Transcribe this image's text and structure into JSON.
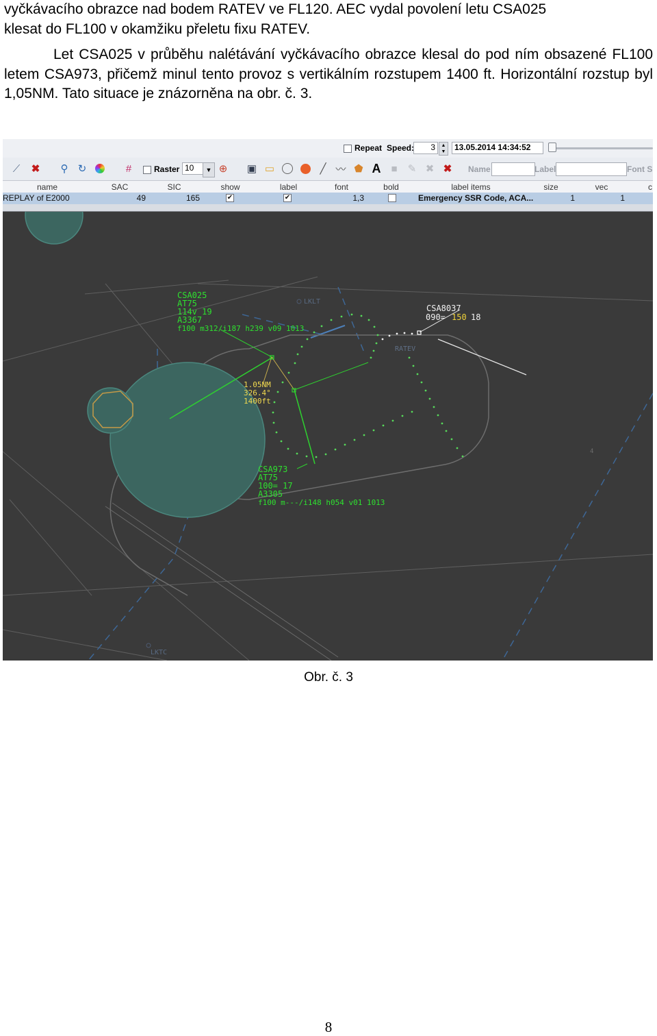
{
  "text": {
    "line1": "vyčkávacího obrazce nad bodem RATEV ve FL120. AEC vydal povolení letu CSA025",
    "line2": "klesat do FL100 v okamžiku přeletu fixu RATEV.",
    "para2": "Let CSA025 v průběhu nalétávání vyčkávacího obrazce klesal do pod ním obsazené FL100 letem CSA973, přičemž minul tento provoz s vertikálním rozstupem 1400 ft. Horizontální rozstup byl 1,05NM. Tato situace je znázorněna na obr. č. 3."
  },
  "toolbar_top": {
    "repeat_label": "Repeat",
    "speed_label": "Speed:",
    "speed_value": "3",
    "datetime": "13.05.2014 14:34:52"
  },
  "toolbar_second": {
    "raster_label": "Raster",
    "raster_value": "10",
    "text_tool_glyph": "A",
    "name_label": "Name",
    "label_label": "Label",
    "font_size_label": "Font Si"
  },
  "table": {
    "headers": [
      "name",
      "SAC",
      "SIC",
      "show",
      "label",
      "font",
      "bold",
      "label items",
      "size",
      "vec",
      "c"
    ],
    "row": {
      "name": "REPLAY of E2000",
      "sac": "49",
      "sic": "165",
      "font": "1,3",
      "label_items": "Emergency SSR Code, ACA...",
      "size": "1",
      "vec": "1"
    }
  },
  "radar": {
    "lklt": "LKLT",
    "ratev": "RATEV",
    "lktc": "LKTC",
    "four": "4",
    "csa025": [
      "CSA025",
      "AT75",
      "114v 19",
      "A3367",
      "f100 m312/i187 h239 v09 1013"
    ],
    "measure": [
      "1.05NM",
      "326.4°",
      "1400ft"
    ],
    "csa8037_name": "CSA8037",
    "csa8037_a": "090=",
    "csa8037_b": "150",
    "csa8037_c": "18",
    "csa973": [
      "CSA973",
      "AT75",
      "100=  17",
      "A3305",
      "f100 m---/i148 h054 v01 1013"
    ]
  },
  "caption": "Obr. č. 3",
  "page_number": "8"
}
